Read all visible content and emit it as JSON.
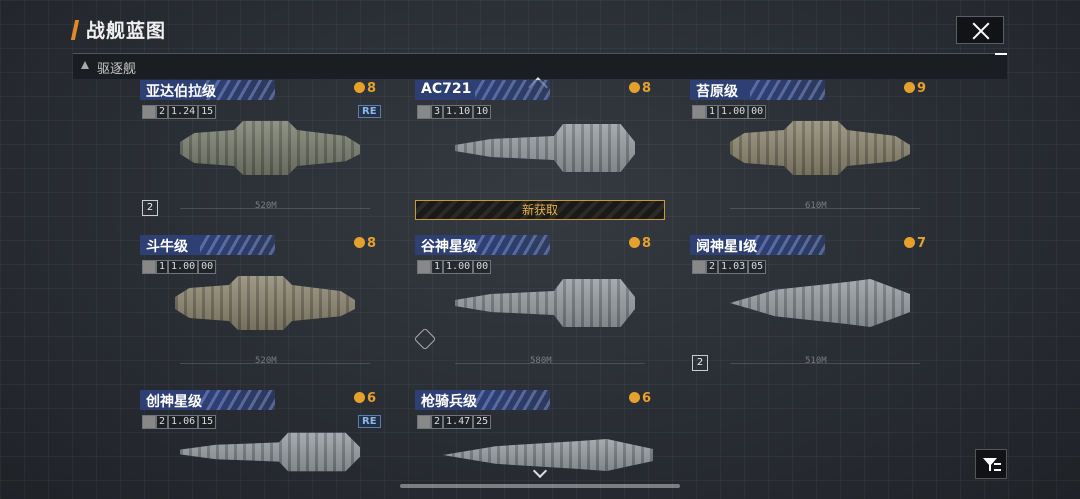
{
  "header": {
    "title": "战舰蓝图"
  },
  "category": {
    "label": "驱逐舰"
  },
  "ships": [
    {
      "name": "亚达伯拉级",
      "rank": "8",
      "count": "2",
      "stat": "1.24",
      "stat2": "15",
      "re": "RE",
      "dup": "2",
      "length": "520M"
    },
    {
      "name": "AC721",
      "rank": "8",
      "count": "3",
      "stat": "1.10",
      "stat2": "10",
      "banner": "新获取"
    },
    {
      "name": "苔原级",
      "rank": "9",
      "count": "1",
      "stat": "1.00",
      "stat2": "00",
      "length": "610M"
    },
    {
      "name": "斗牛级",
      "rank": "8",
      "count": "1",
      "stat": "1.00",
      "stat2": "00",
      "length": "520M"
    },
    {
      "name": "谷神星级",
      "rank": "8",
      "count": "1",
      "stat": "1.00",
      "stat2": "00",
      "length": "580M"
    },
    {
      "name": "阋神星I级",
      "rank": "7",
      "count": "2",
      "stat": "1.03",
      "stat2": "05",
      "dup": "2",
      "length": "510M"
    },
    {
      "name": "创神星级",
      "rank": "6",
      "count": "2",
      "stat": "1.06",
      "stat2": "15",
      "re": "RE"
    },
    {
      "name": "枪骑兵级",
      "rank": "6",
      "count": "2",
      "stat": "1.47",
      "stat2": "25"
    }
  ]
}
